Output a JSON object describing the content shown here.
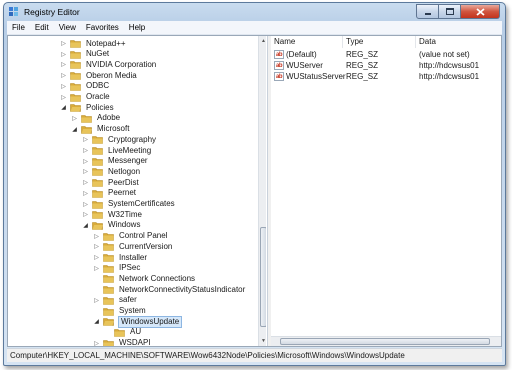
{
  "window": {
    "title": "Registry Editor",
    "app_icon": "registry-editor-icon"
  },
  "menu": {
    "items": [
      "File",
      "Edit",
      "View",
      "Favorites",
      "Help"
    ]
  },
  "tree": {
    "rows": [
      {
        "label": "Notepad++",
        "level": 0,
        "state": "collapsed"
      },
      {
        "label": "NuGet",
        "level": 0,
        "state": "collapsed"
      },
      {
        "label": "NVIDIA Corporation",
        "level": 0,
        "state": "collapsed"
      },
      {
        "label": "Oberon Media",
        "level": 0,
        "state": "collapsed"
      },
      {
        "label": "ODBC",
        "level": 0,
        "state": "collapsed"
      },
      {
        "label": "Oracle",
        "level": 0,
        "state": "collapsed"
      },
      {
        "label": "Policies",
        "level": 0,
        "state": "expanded"
      },
      {
        "label": "Adobe",
        "level": 1,
        "state": "collapsed"
      },
      {
        "label": "Microsoft",
        "level": 1,
        "state": "expanded"
      },
      {
        "label": "Cryptography",
        "level": 2,
        "state": "collapsed"
      },
      {
        "label": "LiveMeeting",
        "level": 2,
        "state": "collapsed"
      },
      {
        "label": "Messenger",
        "level": 2,
        "state": "collapsed"
      },
      {
        "label": "Netlogon",
        "level": 2,
        "state": "collapsed"
      },
      {
        "label": "PeerDist",
        "level": 2,
        "state": "collapsed"
      },
      {
        "label": "Peernet",
        "level": 2,
        "state": "collapsed"
      },
      {
        "label": "SystemCertificates",
        "level": 2,
        "state": "collapsed"
      },
      {
        "label": "W32Time",
        "level": 2,
        "state": "collapsed"
      },
      {
        "label": "Windows",
        "level": 2,
        "state": "expanded"
      },
      {
        "label": "Control Panel",
        "level": 3,
        "state": "collapsed"
      },
      {
        "label": "CurrentVersion",
        "level": 3,
        "state": "collapsed"
      },
      {
        "label": "Installer",
        "level": 3,
        "state": "collapsed"
      },
      {
        "label": "IPSec",
        "level": 3,
        "state": "collapsed"
      },
      {
        "label": "Network Connections",
        "level": 3,
        "state": "none"
      },
      {
        "label": "NetworkConnectivityStatusIndicator",
        "level": 3,
        "state": "none"
      },
      {
        "label": "safer",
        "level": 3,
        "state": "collapsed"
      },
      {
        "label": "System",
        "level": 3,
        "state": "none"
      },
      {
        "label": "WindowsUpdate",
        "level": 3,
        "state": "expanded",
        "selected": true
      },
      {
        "label": "AU",
        "level": 4,
        "state": "none"
      },
      {
        "label": "WSDAPI",
        "level": 3,
        "state": "collapsed"
      }
    ]
  },
  "values": {
    "columns": {
      "name": "Name",
      "type": "Type",
      "data": "Data"
    },
    "rows": [
      {
        "name": "(Default)",
        "type": "REG_SZ",
        "data": "(value not set)",
        "icon": "string-value-icon"
      },
      {
        "name": "WUServer",
        "type": "REG_SZ",
        "data": "http://hdcwsus01",
        "icon": "string-value-icon"
      },
      {
        "name": "WUStatusServer",
        "type": "REG_SZ",
        "data": "http://hdcwsus01",
        "icon": "string-value-icon"
      }
    ],
    "icon_glyph": "ab"
  },
  "statusbar": {
    "path": "Computer\\HKEY_LOCAL_MACHINE\\SOFTWARE\\Wow6432Node\\Policies\\Microsoft\\Windows\\WindowsUpdate"
  },
  "colors": {
    "titlebar": "#b7cde6",
    "selection": "#d6e8fa",
    "folder": "#e8c45a",
    "close_button": "#c3331d"
  }
}
